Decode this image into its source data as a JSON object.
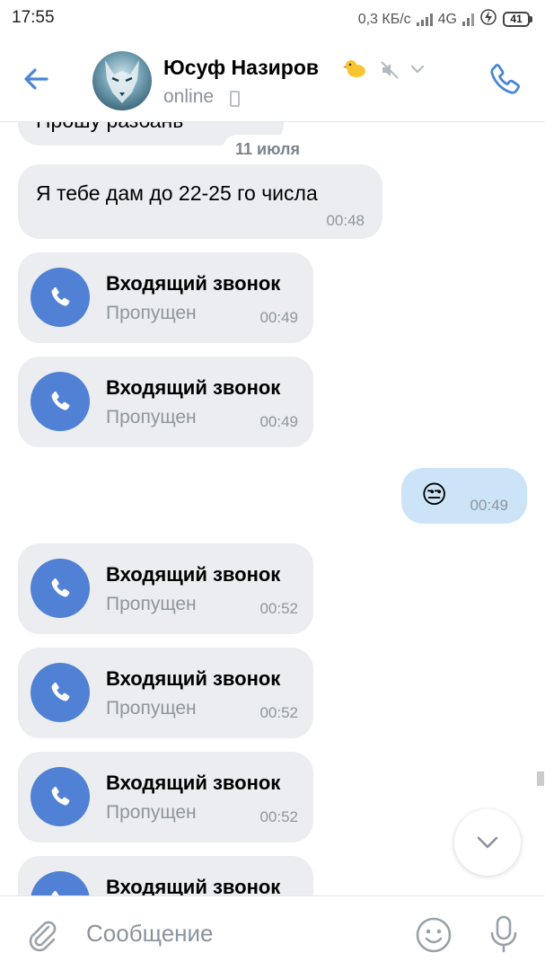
{
  "status_bar": {
    "time": "17:55",
    "network_speed": "0,3 КБ/с",
    "network_type": "4G",
    "battery": "41"
  },
  "header": {
    "contact_name": "Юсуф Назиров",
    "contact_status": "online",
    "icons": [
      "back-arrow-icon",
      "duck-emoji",
      "muted-icon",
      "chevron-down-icon",
      "phone-icon"
    ]
  },
  "chat": {
    "partial_message": "Прошу разбань",
    "date_chip": "11 июля",
    "messages": [
      {
        "type": "text",
        "text": "Я тебе дам до 22-25 го числа",
        "time": "00:48"
      },
      {
        "type": "call",
        "title": "Входящий звонок",
        "status": "Пропущен",
        "time": "00:49"
      },
      {
        "type": "call",
        "title": "Входящий звонок",
        "status": "Пропущен",
        "time": "00:49"
      },
      {
        "type": "emoji",
        "emoji": "😒",
        "time": "00:49"
      },
      {
        "type": "call",
        "title": "Входящий звонок",
        "status": "Пропущен",
        "time": "00:52"
      },
      {
        "type": "call",
        "title": "Входящий звонок",
        "status": "Пропущен",
        "time": "00:52"
      },
      {
        "type": "call",
        "title": "Входящий звонок",
        "status": "Пропущен",
        "time": "00:52"
      },
      {
        "type": "call",
        "title": "Входящий звонок"
      }
    ]
  },
  "composer": {
    "placeholder": "Сообщение"
  },
  "colors": {
    "accent": "#5181d5",
    "incoming_bubble": "#ebedf0",
    "outgoing_bubble": "#cce4f7",
    "secondary_text": "#8f969e"
  }
}
